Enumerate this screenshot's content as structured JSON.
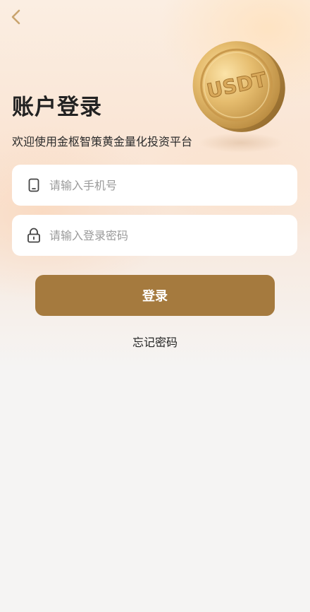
{
  "header": {
    "back_icon": "chevron-left-icon"
  },
  "hero": {
    "coin_text": "USDT",
    "coin_icon": "usdt-coin-icon"
  },
  "login": {
    "title": "账户登录",
    "subtitle": "欢迎使用金枢智策黄金量化投资平台",
    "phone_placeholder": "请输入手机号",
    "phone_icon": "phone-icon",
    "password_placeholder": "请输入登录密码",
    "password_icon": "lock-icon",
    "submit_label": "登录",
    "forgot_label": "忘记密码"
  },
  "colors": {
    "accent": "#a57a3e",
    "back_icon": "#c9a46e",
    "background": "#f5f4f3"
  }
}
